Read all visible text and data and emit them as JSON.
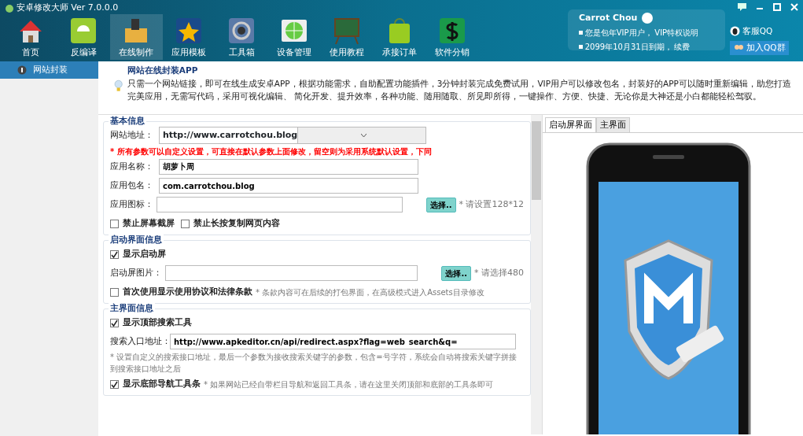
{
  "window": {
    "title": "安卓修改大师 Ver 7.0.0.0"
  },
  "nav": [
    {
      "label": "首页",
      "selected": false
    },
    {
      "label": "反编译",
      "selected": false
    },
    {
      "label": "在线制作",
      "selected": true
    },
    {
      "label": "应用模板",
      "selected": false
    },
    {
      "label": "工具箱",
      "selected": false
    },
    {
      "label": "设备管理",
      "selected": false
    },
    {
      "label": "使用教程",
      "selected": false
    },
    {
      "label": "承接订单",
      "selected": false
    },
    {
      "label": "软件分销",
      "selected": false
    }
  ],
  "user": {
    "name": "Carrot Chou",
    "lines": [
      {
        "text": "您是包年VIP用户，",
        "link": "VIP特权说明"
      },
      {
        "text": "2099年10月31日到期，",
        "link": "续费"
      }
    ]
  },
  "service": {
    "qq": "客服QQ",
    "group": "加入QQ群"
  },
  "sidebar": {
    "items": [
      {
        "label": "网站封装",
        "selected": true
      }
    ]
  },
  "intro": {
    "title": "网站在线封装APP",
    "text": "只需一个网站链接，即可在线生成安卓APP，根据功能需求，自助配置功能插件，3分钟封装完成免费试用，VIP用户可以修改包名，封装好的APP可以随时重新编辑，助您打造完美应用，无需写代码，采用可视化编辑、 简化开发、提升效率，各种功能、随用随取、所见即所得，一键操作、方便、快捷、无论你是大神还是小白都能轻松驾驭。"
  },
  "sections": [
    {
      "title": "基本信息",
      "rows": [
        {
          "kind": "select",
          "label": "网站地址：",
          "value": "http://www.carrotchou.blog"
        },
        {
          "kind": "warning",
          "text": "* 所有参数可以自定义设置，可直接在默认参数上面修改，留空则为采用系统默认设置，下同"
        },
        {
          "kind": "input",
          "label": "应用名称：",
          "value": "胡萝卜周"
        },
        {
          "kind": "input",
          "label": "应用包名：",
          "value": "com.carrotchou.blog"
        },
        {
          "kind": "input",
          "label": "应用图标：",
          "value": "",
          "button": "选择..",
          "hint": "* 请设置128*12"
        },
        {
          "kind": "checks",
          "items": [
            {
              "label": "禁止屏幕截屏",
              "checked": false
            },
            {
              "label": "禁止长按复制网页内容",
              "checked": false
            }
          ]
        }
      ]
    },
    {
      "title": "启动界面信息",
      "rows": [
        {
          "kind": "checks",
          "items": [
            {
              "label": "显示启动屏",
              "checked": true
            }
          ]
        },
        {
          "kind": "input",
          "label": "启动屏图片：",
          "value": "",
          "button": "选择..",
          "hint": "* 请选择480"
        },
        {
          "kind": "check",
          "label": "首次使用显示使用协议和法律条款",
          "checked": false,
          "hint": "* 条款内容可在后续的打包界面，在高级模式进入Assets目录修改"
        }
      ]
    },
    {
      "title": "主界面信息",
      "rows": [
        {
          "kind": "checks",
          "items": [
            {
              "label": "显示顶部搜索工具",
              "checked": true
            }
          ]
        },
        {
          "kind": "input",
          "label": "搜索入口地址：",
          "value": "http://www.apkeditor.cn/api/redirect.aspx?flag=web_search&q="
        },
        {
          "kind": "note",
          "text": "* 设置自定义的搜索接口地址，最后一个参数为接收搜索关键字的参数，包含=号字符，系统会自动将搜索关键字拼接到搜索接口地址之后"
        },
        {
          "kind": "check",
          "label": "显示底部导航工具条",
          "checked": true,
          "hint": "* 如果网站已经自带栏目导航和返回工具条，请在这里关闭顶部和底部的工具条即可"
        }
      ]
    }
  ],
  "preview": {
    "tabs": [
      {
        "label": "启动屏界面",
        "selected": true
      },
      {
        "label": "主界面",
        "selected": false
      }
    ]
  }
}
